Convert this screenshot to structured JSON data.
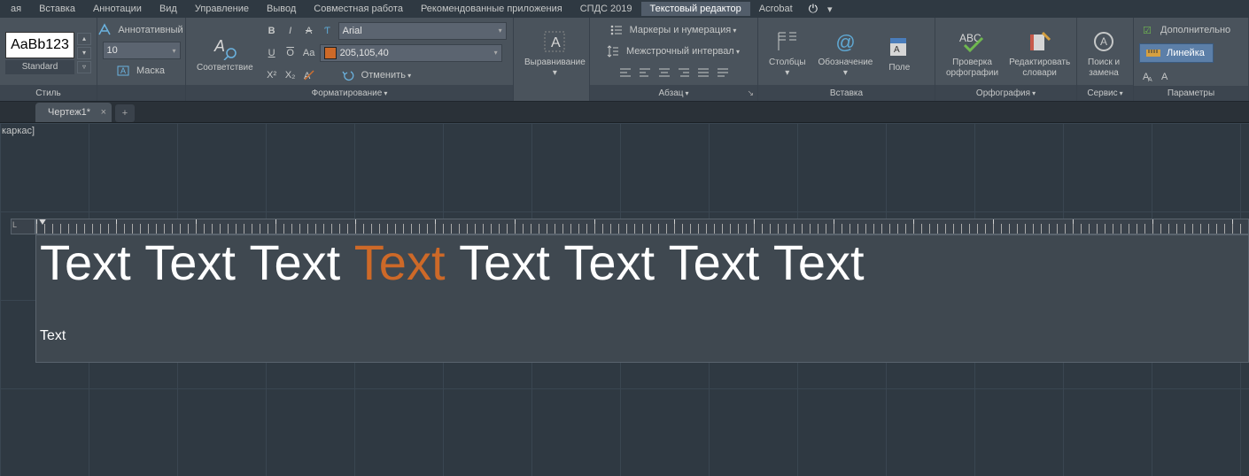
{
  "menu": {
    "items": [
      "ая",
      "Вставка",
      "Аннотации",
      "Вид",
      "Управление",
      "Вывод",
      "Совместная работа",
      "Рекомендованные приложения",
      "СПДС 2019",
      "Текстовый редактор",
      "Acrobat"
    ],
    "active_index": 9
  },
  "ribbon": {
    "style": {
      "preview": "AaBb123",
      "name": "Standard",
      "panel_label": "Стиль"
    },
    "format": {
      "annotative": "Аннотативный",
      "font_size": "10",
      "mask": "Маска",
      "match": "Соответствие",
      "font_name": "Arial",
      "color_value": "205,105,40",
      "undo": "Отменить",
      "panel_label": "Форматирование"
    },
    "align": {
      "label": "Выравнивание"
    },
    "paragraph": {
      "bullets": "Маркеры и нумерация",
      "spacing": "Межстрочный интервал",
      "panel_label": "Абзац"
    },
    "columns": "Столбцы",
    "symbol": "Обозначение",
    "field": "Поле",
    "insert_panel": "Вставка",
    "spell": {
      "check": "Проверка\nорфографии",
      "dict": "Редактировать\nсловари",
      "panel_label": "Орфография"
    },
    "findreplace": "Поиск и\nзамена",
    "tools_panel": "Сервис",
    "extras_cb": "Дополнительно",
    "ruler_btn": "Линейка",
    "params_panel": "Параметры"
  },
  "tabs": {
    "doc": "Чертеж1*"
  },
  "canvas": {
    "top_status": "каркас]",
    "ruler_corner": "L",
    "line1_words": [
      "Text",
      "Text",
      "Text",
      "Text",
      "Text",
      "Text",
      "Text",
      "Text"
    ],
    "line1_orange_index": 3,
    "line2": "Text"
  }
}
